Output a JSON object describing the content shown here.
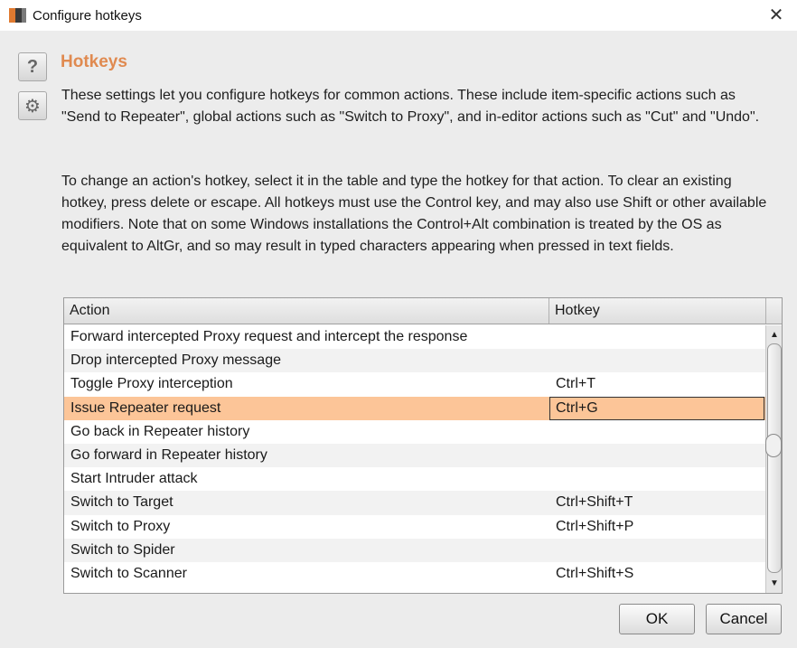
{
  "window": {
    "title": "Configure hotkeys",
    "close_glyph": "✕"
  },
  "sidebar": {
    "help_glyph": "?",
    "gear_glyph": "⚙"
  },
  "section": {
    "heading": "Hotkeys",
    "paragraph1": "These settings let you configure hotkeys for common actions. These include item-specific actions such as \"Send to Repeater\", global actions such as \"Switch to Proxy\", and in-editor actions such as \"Cut\" and \"Undo\".",
    "paragraph2": "To change an action's hotkey, select it in the table and type the hotkey for that action. To clear an existing hotkey, press delete or escape. All hotkeys must use the Control key, and may also use Shift or other available modifiers. Note that on some Windows installations the Control+Alt combination is treated by the OS as equivalent to AltGr, and so may result in typed characters appearing when pressed in text fields."
  },
  "table": {
    "columns": {
      "action": "Action",
      "hotkey": "Hotkey"
    },
    "rows": [
      {
        "action": "Forward intercepted Proxy request and intercept the response",
        "hotkey": ""
      },
      {
        "action": "Drop intercepted Proxy message",
        "hotkey": ""
      },
      {
        "action": "Toggle Proxy interception",
        "hotkey": "Ctrl+T"
      },
      {
        "action": "Issue Repeater request",
        "hotkey": "Ctrl+G",
        "selected": true
      },
      {
        "action": "Go back in Repeater history",
        "hotkey": ""
      },
      {
        "action": "Go forward in Repeater history",
        "hotkey": ""
      },
      {
        "action": "Start Intruder attack",
        "hotkey": ""
      },
      {
        "action": "Switch to Target",
        "hotkey": "Ctrl+Shift+T"
      },
      {
        "action": "Switch to Proxy",
        "hotkey": "Ctrl+Shift+P"
      },
      {
        "action": "Switch to Spider",
        "hotkey": ""
      },
      {
        "action": "Switch to Scanner",
        "hotkey": "Ctrl+Shift+S"
      }
    ],
    "scroll_up_glyph": "▲",
    "scroll_down_glyph": "▼"
  },
  "buttons": {
    "ok": "OK",
    "cancel": "Cancel"
  },
  "colors": {
    "accent": "#e08a50",
    "selected_row": "#fcc598"
  }
}
